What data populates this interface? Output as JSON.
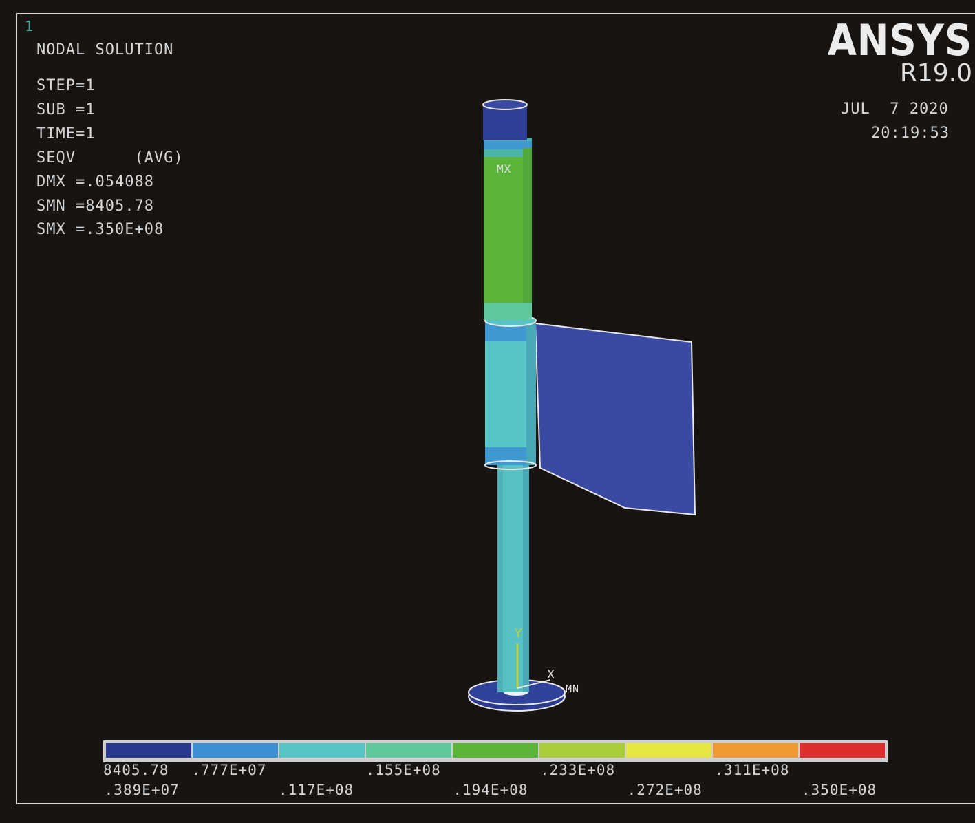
{
  "window_number": "1",
  "brand": {
    "name": "ANSYS",
    "release": "R19.0"
  },
  "datetime": {
    "date": "JUL  7 2020",
    "time": "20:19:53"
  },
  "info": {
    "title": "NODAL SOLUTION",
    "step": "STEP=1",
    "sub": "SUB =1",
    "time": "TIME=1",
    "result": "SEQV      (AVG)",
    "dmx": "DMX =.054088",
    "smn": "SMN =8405.78",
    "smx": "SMX =.350E+08"
  },
  "model_labels": {
    "mx": "MX",
    "mn": "MN",
    "axis_y": "Y",
    "axis_x": "X"
  },
  "legend": {
    "colors": [
      "#2b3a8c",
      "#3d8fd1",
      "#56c4c6",
      "#5fc79a",
      "#5bb53a",
      "#a9cc3a",
      "#e6e640",
      "#ef9a35",
      "#dd2f2f"
    ],
    "labels_top": [
      "8405.78",
      ".777E+07",
      ".155E+08",
      ".233E+08",
      ".311E+08"
    ],
    "labels_bottom": [
      ".389E+07",
      ".117E+08",
      ".194E+08",
      ".272E+08",
      ".350E+08"
    ]
  }
}
